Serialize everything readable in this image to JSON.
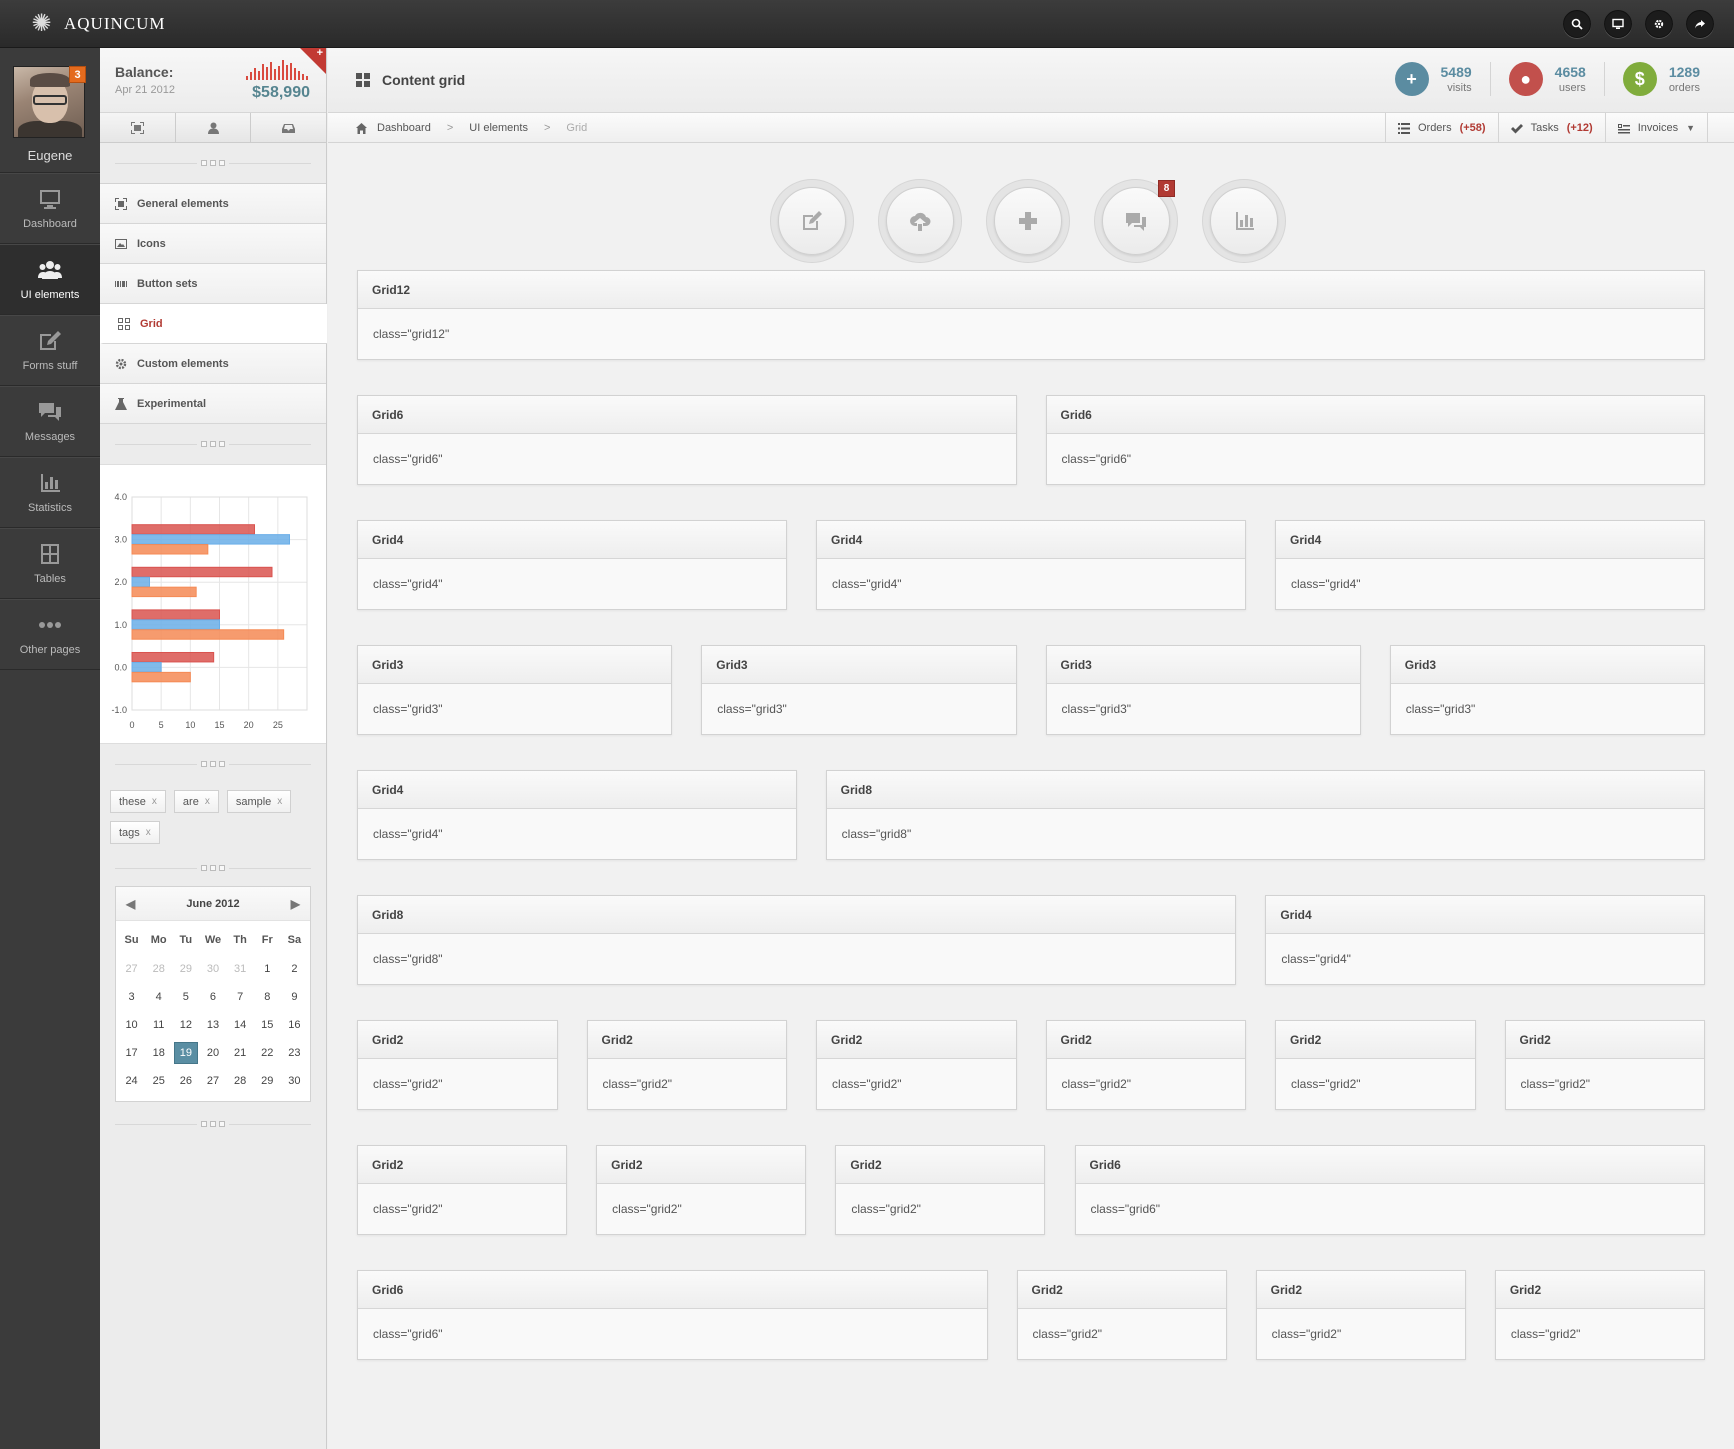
{
  "app": {
    "name": "AQUINCUM"
  },
  "top_icons": [
    {
      "name": "search-icon"
    },
    {
      "name": "monitor-icon"
    },
    {
      "name": "gear-icon"
    },
    {
      "name": "share-icon"
    }
  ],
  "profile": {
    "name": "Eugene",
    "badge": "3"
  },
  "nav": [
    {
      "label": "Dashboard",
      "icon": "monitor-icon"
    },
    {
      "label": "UI elements",
      "icon": "users-icon",
      "active": true
    },
    {
      "label": "Forms stuff",
      "icon": "edit-icon"
    },
    {
      "label": "Messages",
      "icon": "chat-icon"
    },
    {
      "label": "Statistics",
      "icon": "stats-icon"
    },
    {
      "label": "Tables",
      "icon": "table-icon"
    },
    {
      "label": "Other pages",
      "icon": "dots-icon"
    }
  ],
  "balance": {
    "label": "Balance:",
    "date": "Apr 21 2012",
    "amount": "$58,990",
    "corner": "+"
  },
  "submenu": [
    {
      "label": "General elements"
    },
    {
      "label": "Icons"
    },
    {
      "label": "Button sets"
    },
    {
      "label": "Grid",
      "active": true
    },
    {
      "label": "Custom elements"
    },
    {
      "label": "Experimental"
    }
  ],
  "chart_data": {
    "type": "bar",
    "orientation": "horizontal",
    "categories": [
      0,
      1,
      2,
      3
    ],
    "series": [
      {
        "color": "#d9534f",
        "values": [
          14,
          15,
          24,
          21
        ]
      },
      {
        "color": "#6aaee8",
        "values": [
          5,
          15,
          3,
          27
        ]
      },
      {
        "color": "#f58a55",
        "values": [
          10,
          26,
          11,
          13
        ]
      }
    ],
    "xlim": [
      0,
      30
    ],
    "ylim": [
      -1,
      4
    ],
    "xticks": [
      "0",
      "5",
      "10",
      "15",
      "20",
      "25"
    ],
    "yticks": [
      "-1.0",
      "0.0",
      "1.0",
      "2.0",
      "3.0",
      "4.0"
    ],
    "grid": true
  },
  "tags": [
    {
      "label": "these"
    },
    {
      "label": "are"
    },
    {
      "label": "sample"
    },
    {
      "label": "tags"
    }
  ],
  "calendar": {
    "month": "June 2012",
    "dow": [
      "Su",
      "Mo",
      "Tu",
      "We",
      "Th",
      "Fr",
      "Sa"
    ],
    "days": [
      [
        "27",
        "28",
        "29",
        "30",
        "31",
        "1",
        "2"
      ],
      [
        "3",
        "4",
        "5",
        "6",
        "7",
        "8",
        "9"
      ],
      [
        "10",
        "11",
        "12",
        "13",
        "14",
        "15",
        "16"
      ],
      [
        "17",
        "18",
        "19",
        "20",
        "21",
        "22",
        "23"
      ],
      [
        "24",
        "25",
        "26",
        "27",
        "28",
        "29",
        "30"
      ]
    ],
    "today": "19"
  },
  "header": {
    "title": "Content grid",
    "stats": [
      {
        "value": "5489",
        "label": "visits",
        "symbol": "+",
        "color": "#5b8ca1"
      },
      {
        "value": "4658",
        "label": "users",
        "symbol": "●",
        "color": "#c2504c"
      },
      {
        "value": "1289",
        "label": "orders",
        "symbol": "$",
        "color": "#80ac3c"
      }
    ]
  },
  "breadcrumb": {
    "items": [
      "Dashboard",
      "UI elements",
      "Grid"
    ],
    "actions": [
      {
        "label": "Orders",
        "count": "(+58)"
      },
      {
        "label": "Tasks",
        "count": "(+12)"
      },
      {
        "label": "Invoices",
        "count": ""
      }
    ]
  },
  "quick_buttons": [
    {
      "icon": "edit-icon"
    },
    {
      "icon": "cloud-upload-icon"
    },
    {
      "icon": "plus-icon"
    },
    {
      "icon": "chat-icon",
      "badge": "8"
    },
    {
      "icon": "stats-icon"
    }
  ],
  "grid_rows": [
    [
      {
        "title": "Grid12",
        "body": "class=\"grid12\""
      }
    ],
    [
      {
        "title": "Grid6",
        "body": "class=\"grid6\""
      },
      {
        "title": "Grid6",
        "body": "class=\"grid6\""
      }
    ],
    [
      {
        "title": "Grid4",
        "body": "class=\"grid4\""
      },
      {
        "title": "Grid4",
        "body": "class=\"grid4\""
      },
      {
        "title": "Grid4",
        "body": "class=\"grid4\""
      }
    ],
    [
      {
        "title": "Grid3",
        "body": "class=\"grid3\""
      },
      {
        "title": "Grid3",
        "body": "class=\"grid3\""
      },
      {
        "title": "Grid3",
        "body": "class=\"grid3\""
      },
      {
        "title": "Grid3",
        "body": "class=\"grid3\""
      }
    ],
    [
      {
        "title": "Grid4",
        "body": "class=\"grid4\""
      },
      {
        "title": "Grid8",
        "body": "class=\"grid8\""
      }
    ],
    [
      {
        "title": "Grid8",
        "body": "class=\"grid8\""
      },
      {
        "title": "Grid4",
        "body": "class=\"grid4\""
      }
    ],
    [
      {
        "title": "Grid2",
        "body": "class=\"grid2\""
      },
      {
        "title": "Grid2",
        "body": "class=\"grid2\""
      },
      {
        "title": "Grid2",
        "body": "class=\"grid2\""
      },
      {
        "title": "Grid2",
        "body": "class=\"grid2\""
      },
      {
        "title": "Grid2",
        "body": "class=\"grid2\""
      },
      {
        "title": "Grid2",
        "body": "class=\"grid2\""
      }
    ],
    [
      {
        "title": "Grid2",
        "body": "class=\"grid2\""
      },
      {
        "title": "Grid2",
        "body": "class=\"grid2\""
      },
      {
        "title": "Grid2",
        "body": "class=\"grid2\""
      },
      {
        "title": "Grid6",
        "body": "class=\"grid6\""
      }
    ],
    [
      {
        "title": "Grid6",
        "body": "class=\"grid6\""
      },
      {
        "title": "Grid2",
        "body": "class=\"grid2\""
      },
      {
        "title": "Grid2",
        "body": "class=\"grid2\""
      },
      {
        "title": "Grid2",
        "body": "class=\"grid2\""
      }
    ]
  ]
}
